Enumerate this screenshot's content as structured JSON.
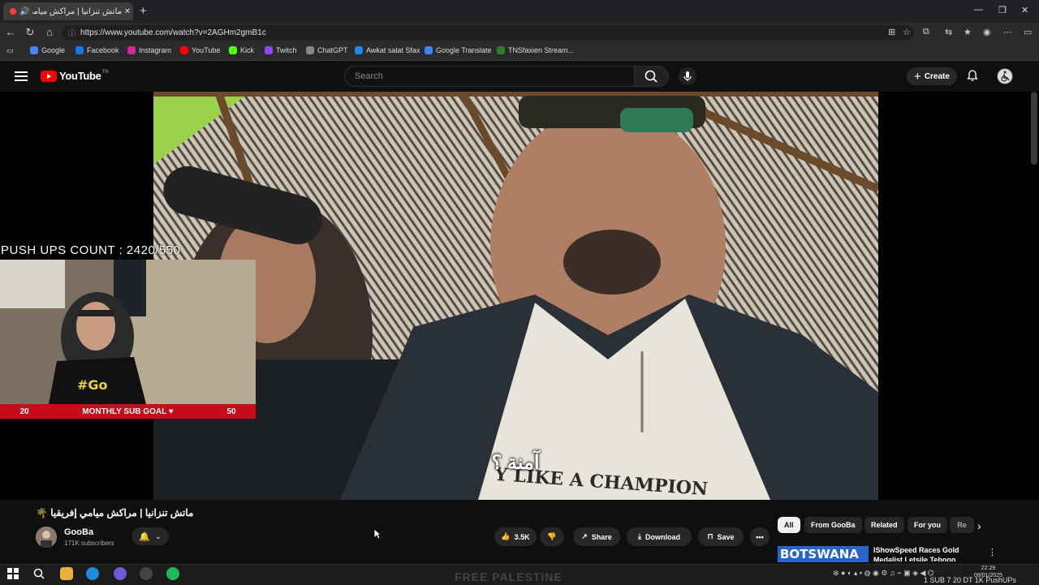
{
  "browser": {
    "tab_title": "ماتش تنزانيا | مراكش ميامي إفر",
    "url": "https://www.youtube.com/watch?v=2AGHm2gmB1c",
    "bookmarks": [
      {
        "label": "Google",
        "color": "#4285f4"
      },
      {
        "label": "Facebook",
        "color": "#1877f2"
      },
      {
        "label": "Instagram",
        "color": "#d6249f"
      },
      {
        "label": "YouTube",
        "color": "#ff0000"
      },
      {
        "label": "Kick",
        "color": "#53fc18"
      },
      {
        "label": "Twitch",
        "color": "#9146ff"
      },
      {
        "label": "ChatGPT",
        "color": "#888888"
      },
      {
        "label": "Awkat salat Sfax",
        "color": "#1e88e5"
      },
      {
        "label": "Google Translate",
        "color": "#4285f4"
      },
      {
        "label": "TNSfaxien Stream...",
        "color": "#2e7d32"
      }
    ]
  },
  "youtube": {
    "logo_text": "YouTube",
    "logo_suffix": "TN",
    "search_placeholder": "Search",
    "create_label": "Create"
  },
  "video": {
    "subtitle": "آمنة ؟",
    "shirt_text": "Y LIKE A CHAMPION",
    "title": "ماتش تنزانيا | مراكش ميامي إفريقيا 🌴",
    "channel": "GooBa",
    "subscribers": "171K subscribers",
    "likes": "3.5K",
    "share_label": "Share",
    "download_label": "Download",
    "save_label": "Save"
  },
  "overlay": {
    "pushups": "PUSH UPS COUNT : 2420/550",
    "goal_current": "20",
    "goal_label": "MONTHLY SUB GOAL ♥",
    "goal_target": "50"
  },
  "chips": [
    "All",
    "From GooBa",
    "Related",
    "For you",
    "Re"
  ],
  "recommendation": {
    "thumb_text": "BOTSWANA",
    "title": "IShowSpeed Races Gold Medalist Letsile Tebogo"
  },
  "taskbar": {
    "banner_text": "FREE PALESTINE",
    "clock_time": "22:29",
    "clock_date": "09/01/2025",
    "ticker": "1 SUB 7 20 DT 1K PushUPs"
  }
}
